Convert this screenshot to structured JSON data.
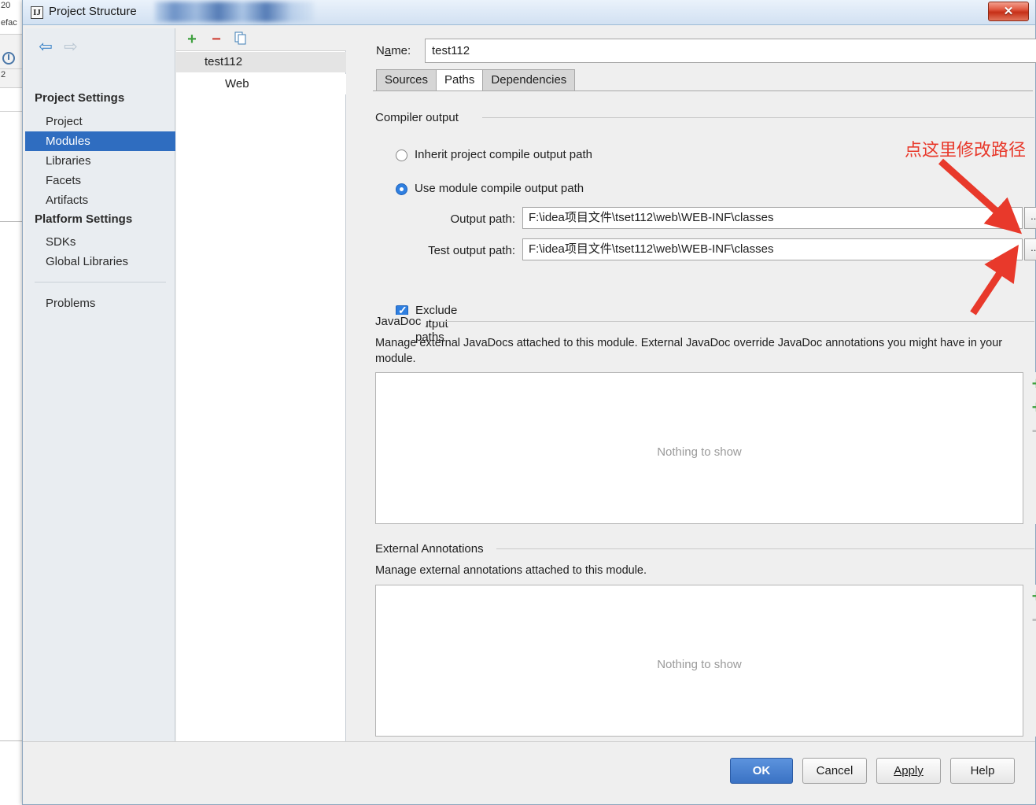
{
  "background": {
    "fragments": [
      "20",
      "efac",
      "2"
    ]
  },
  "window": {
    "title": "Project Structure",
    "app_icon": "intellij-idea-icon",
    "close_label": "✕"
  },
  "sidebar": {
    "nav": {
      "back": "◀",
      "forward": "▶"
    },
    "groups": [
      {
        "label": "Project Settings",
        "items": [
          {
            "label": "Project",
            "selected": false
          },
          {
            "label": "Modules",
            "selected": true
          },
          {
            "label": "Libraries",
            "selected": false
          },
          {
            "label": "Facets",
            "selected": false
          },
          {
            "label": "Artifacts",
            "selected": false
          }
        ]
      },
      {
        "label": "Platform Settings",
        "items": [
          {
            "label": "SDKs",
            "selected": false
          },
          {
            "label": "Global Libraries",
            "selected": false
          }
        ]
      }
    ],
    "problems_label": "Problems"
  },
  "tree": {
    "toolbar": {
      "add": "+",
      "remove": "−",
      "copy": "copy-icon"
    },
    "nodes": [
      {
        "label": "test112",
        "icon": "module-icon",
        "selected": true,
        "expanded": true
      },
      {
        "label": "Web",
        "icon": "web-facet-icon",
        "selected": false
      }
    ]
  },
  "detail": {
    "name_label": "Name:",
    "name_value": "test112",
    "name_placeholder": "",
    "tabs": [
      {
        "label": "Sources",
        "active": false
      },
      {
        "label": "Paths",
        "active": true
      },
      {
        "label": "Dependencies",
        "active": false
      }
    ],
    "compiler_output": {
      "caption": "Compiler output",
      "radio_inherit": "Inherit project compile output path",
      "radio_module": "Use module compile output path",
      "selected_radio": "module",
      "output_path_label": "Output path:",
      "output_path_value": "F:\\idea项目文件\\tset112\\web\\WEB-INF\\classes",
      "test_output_path_label": "Test output path:",
      "test_output_path_value": "F:\\idea项目文件\\tset112\\web\\WEB-INF\\classes",
      "browse_label": "...",
      "exclude_label": "Exclude output paths",
      "exclude_checked": true
    },
    "javadoc": {
      "caption": "JavaDoc",
      "description": "Manage external JavaDocs attached to this module. External JavaDoc override JavaDoc annotations you might have in your module.",
      "empty_text": "Nothing to show",
      "actions": [
        {
          "name": "add-javadoc-path",
          "label": "+"
        },
        {
          "name": "add-javadoc-url",
          "label": "+"
        },
        {
          "name": "remove-javadoc",
          "label": "−"
        }
      ]
    },
    "annotations": {
      "caption": "External Annotations",
      "description": "Manage external annotations attached to this module.",
      "empty_text": "Nothing to show",
      "actions": [
        {
          "name": "add-annotation-path",
          "label": "+"
        },
        {
          "name": "remove-annotation",
          "label": "−"
        }
      ]
    }
  },
  "footer": {
    "ok": "OK",
    "cancel": "Cancel",
    "apply": "Apply",
    "help": "Help"
  },
  "annotation": {
    "text": "点这里修改路径",
    "color": "#e8392b"
  },
  "colors": {
    "selection_blue": "#2f6dc0",
    "accent_blue": "#2f7fe0",
    "annotation_red": "#e8392b",
    "dialog_bg": "#efefef",
    "sidebar_bg": "#e9edf1"
  }
}
